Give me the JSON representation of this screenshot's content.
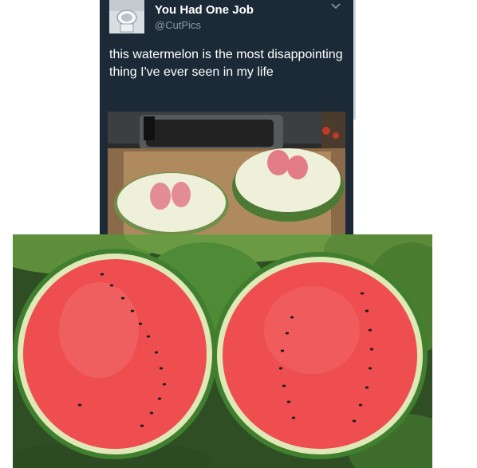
{
  "tweet": {
    "display_name": "You Had One Job",
    "handle": "@CutPics",
    "text": "this watermelon is the most disappointing thing I've ever seen in my life",
    "avatar_icon": "toilet-avatar-icon",
    "menu_icon": "chevron-down-icon",
    "photo_alt": "pale watermelon halves with small pink centers",
    "background_color": "#1c2a38"
  },
  "comparison_photo": {
    "alt": "ripe red watermelon halves with black seeds"
  },
  "colors": {
    "rind_green": "#3f7f2e",
    "flesh_red": "#ee4e4f",
    "pale_flesh": "#ecefd8",
    "pink_core": "#e48c93"
  }
}
